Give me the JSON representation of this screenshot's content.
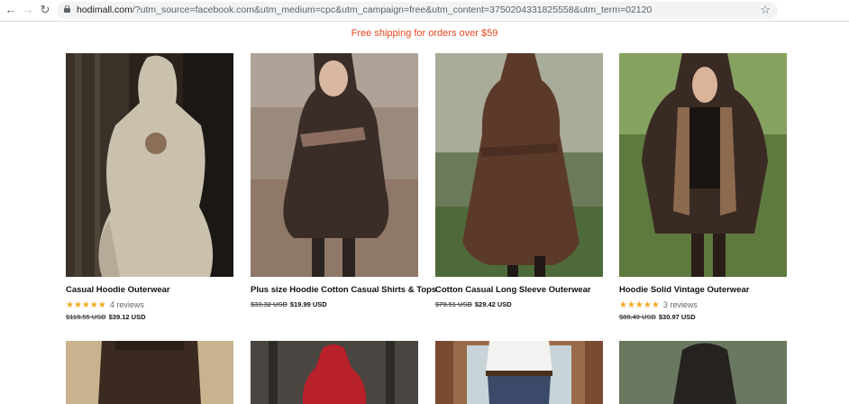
{
  "browser": {
    "url_host": "hodimall.com",
    "url_rest": "/?utm_source=facebook.com&utm_medium=cpc&utm_campaign=free&utm_content=3750204331825558&utm_term=02120"
  },
  "promo": {
    "text": "Free shipping for orders over $59"
  },
  "products": [
    {
      "title": "Casual Hoodie Outerwear",
      "stars": "★★★★★",
      "reviews": "4 reviews",
      "old_price": "$118.55 USD",
      "price": "$39.12 USD"
    },
    {
      "title": "Plus size Hoodie Cotton Casual Shirts & Tops",
      "stars": "",
      "reviews": "",
      "old_price": "$33.32 USD",
      "price": "$19.99 USD"
    },
    {
      "title": "Cotton Casual Long Sleeve Outerwear",
      "stars": "",
      "reviews": "",
      "old_price": "$79.51 USD",
      "price": "$29.42 USD"
    },
    {
      "title": "Hoodie Solid Vintage Outerwear",
      "stars": "★★★★★",
      "reviews": "3 reviews",
      "old_price": "$88.49 USD",
      "price": "$30.97 USD"
    }
  ],
  "colors": {
    "promo": "#e8451f",
    "stars": "#f5a623"
  }
}
